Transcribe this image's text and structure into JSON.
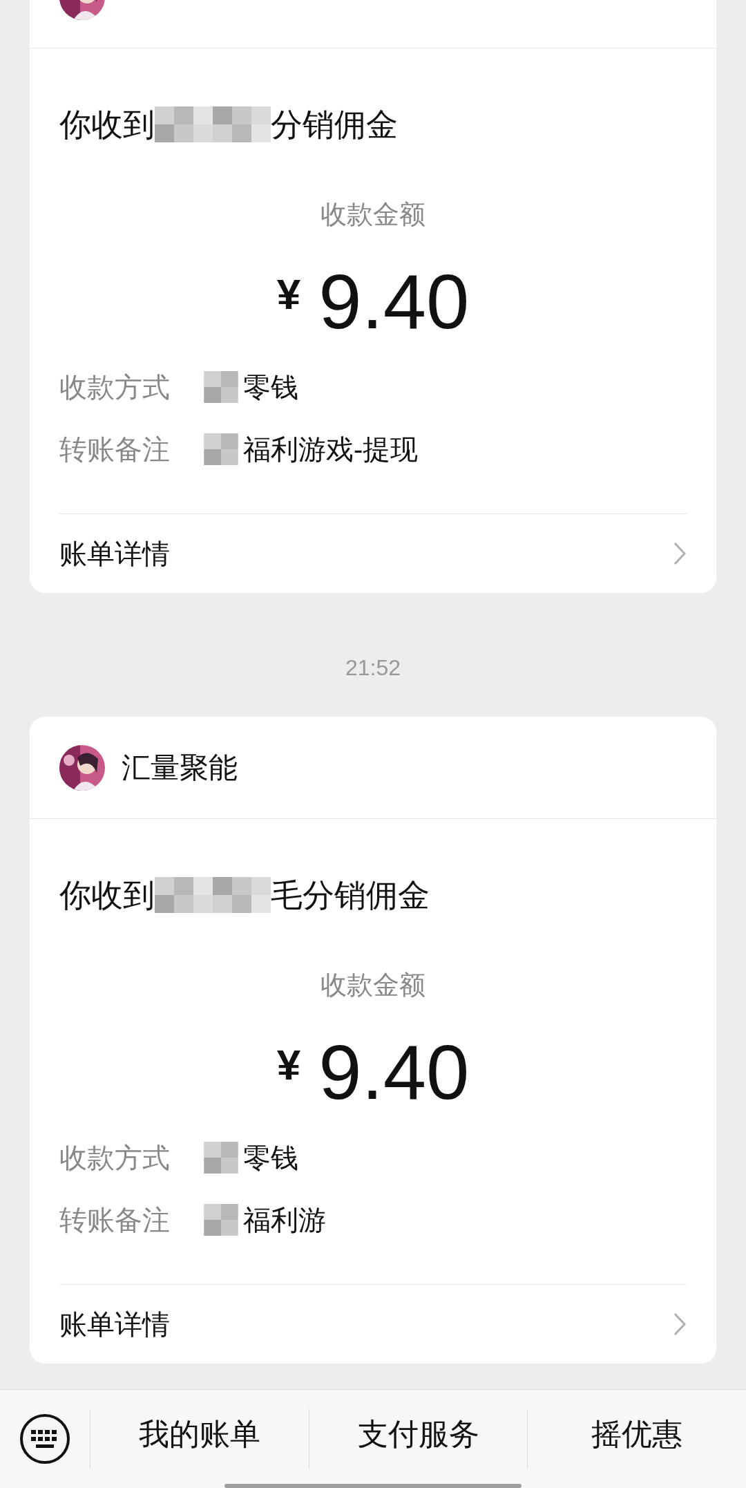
{
  "messages": [
    {
      "title_parts": [
        "你收到",
        "分销佣金"
      ],
      "amount_label": "收款金额",
      "currency": "¥",
      "amount": "9.40",
      "rows": [
        {
          "label": "收款方式",
          "value": "零钱"
        },
        {
          "label": "转账备注",
          "value": "福利游戏-提现"
        }
      ],
      "details_link": "账单详情"
    },
    {
      "time": "21:52",
      "sender": "汇量聚能",
      "title_parts": [
        "你收到",
        "毛分销佣金"
      ],
      "amount_label": "收款金额",
      "currency": "¥",
      "amount": "9.40",
      "rows": [
        {
          "label": "收款方式",
          "value": "零钱"
        },
        {
          "label": "转账备注",
          "value": "福利游"
        }
      ],
      "details_link": "账单详情"
    }
  ],
  "bottom_bar": {
    "tabs": [
      "我的账单",
      "支付服务",
      "摇优惠"
    ]
  }
}
